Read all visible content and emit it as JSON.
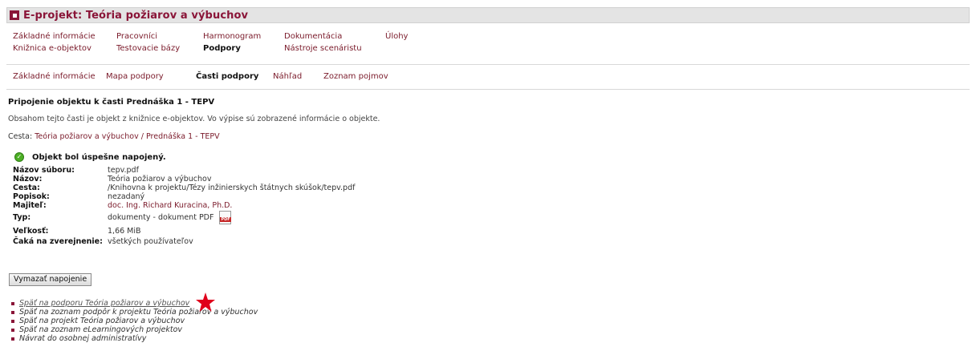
{
  "header": {
    "title": "E-projekt: Teória požiarov a výbuchov"
  },
  "menu1": {
    "zakladne": "Základné informácie",
    "pracovnici": "Pracovníci",
    "harmonogram": "Harmonogram",
    "dokumentacia": "Dokumentácia",
    "ulohy": "Úlohy",
    "kniznica": "Knižnica e-objektov",
    "testovacie": "Testovacie bázy",
    "podpory": "Podpory",
    "nastroje": "Nástroje scenáristu"
  },
  "menu2": {
    "zakladne": "Základné informácie",
    "mapa": "Mapa podpory",
    "casti": "Časti podpory",
    "nahlad": "Náhľad",
    "zoznam": "Zoznam pojmov"
  },
  "main": {
    "heading": "Pripojenie objektu k časti Prednáška 1 - TEPV",
    "description": "Obsahom tejto časti je objekt z knižnice e-objektov. Vo výpise sú zobrazené informácie o objekte.",
    "path_label": "Cesta:",
    "path_link1": "Teória požiarov a výbuchov",
    "path_sep": " / ",
    "path_link2": "Prednáška 1 - TEPV",
    "success": "Objekt bol úspešne napojený.",
    "info": {
      "file_label": "Názov súboru:",
      "file": "tepv.pdf",
      "name_label": "Názov:",
      "name": "Teória požiarov a výbuchov",
      "path_label": "Cesta:",
      "path": "/Knihovna k projektu/Tézy inžinierskych štátnych skúšok/tepv.pdf",
      "desc_label": "Popisok:",
      "desc": "nezadaný",
      "owner_label": "Majiteľ:",
      "owner": "doc. Ing. Richard Kuracina, Ph.D.",
      "type_label": "Typ:",
      "type": "dokumenty - dokument PDF",
      "size_label": "Veľkosť:",
      "size": "1,66 MiB",
      "pub_label": "Čaká na zverejnenie:",
      "pub": "všetkých používateľov"
    },
    "remove_button": "Vymazať napojenie",
    "links": [
      "Späť na podporu Teória požiarov a výbuchov",
      "Späť na zoznam podpôr k projektu Teória požiarov a výbuchov",
      "Späť na projekt Teória požiarov a výbuchov",
      "Späť na zoznam eLearningových projektov",
      "Návrat do osobnej administratívy"
    ]
  },
  "icons": {
    "pdf_badge": "PDF",
    "check": "✓",
    "star": "red-star-icon"
  },
  "colors": {
    "brand": "#8a1538",
    "success": "#4caf25",
    "star": "#e0001b"
  }
}
